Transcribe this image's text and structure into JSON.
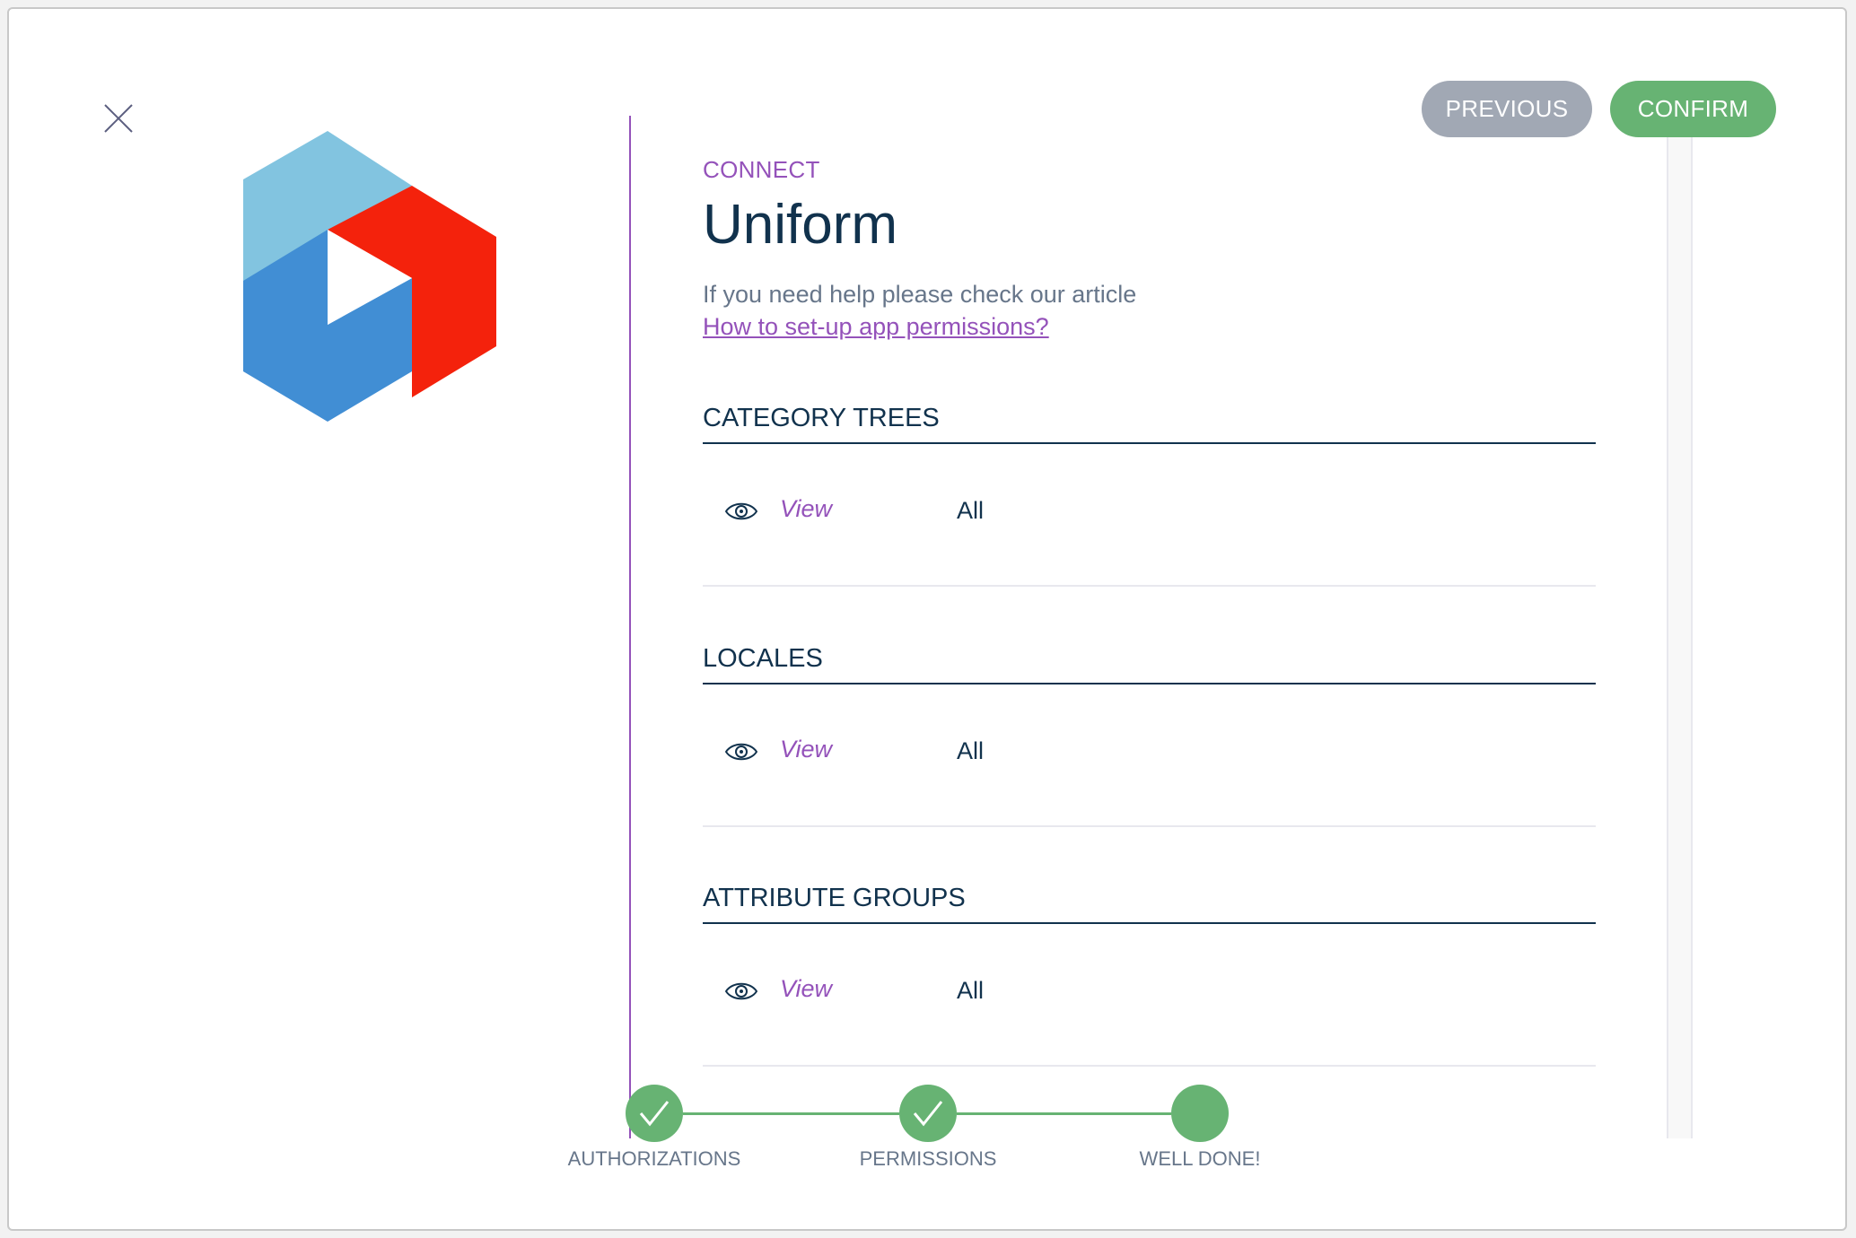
{
  "header": {
    "eyebrow": "CONNECT",
    "title": "Uniform",
    "help_text": "If you need help please check our article",
    "help_link": "How to set-up app permissions?"
  },
  "actions": {
    "previous_label": "PREVIOUS",
    "confirm_label": "CONFIRM"
  },
  "sections": [
    {
      "title": "CATEGORY TREES",
      "permission": {
        "icon": "eye-icon",
        "action": "View",
        "value": "All"
      }
    },
    {
      "title": "LOCALES",
      "permission": {
        "icon": "eye-icon",
        "action": "View",
        "value": "All"
      }
    },
    {
      "title": "ATTRIBUTE GROUPS",
      "permission": {
        "icon": "eye-icon",
        "action": "View",
        "value": "All"
      }
    }
  ],
  "stepper": {
    "steps": [
      {
        "label": "AUTHORIZATIONS",
        "state": "completed"
      },
      {
        "label": "PERMISSIONS",
        "state": "completed"
      },
      {
        "label": "WELL DONE!",
        "state": "current"
      }
    ]
  },
  "colors": {
    "accent": "#9452ba",
    "primary_text": "#11324d",
    "secondary_text": "#67768a",
    "success": "#67b373",
    "neutral_button": "#a1a8b4",
    "logo_light_blue": "#82c4e0",
    "logo_blue": "#418ed4",
    "logo_red": "#f4220c"
  }
}
